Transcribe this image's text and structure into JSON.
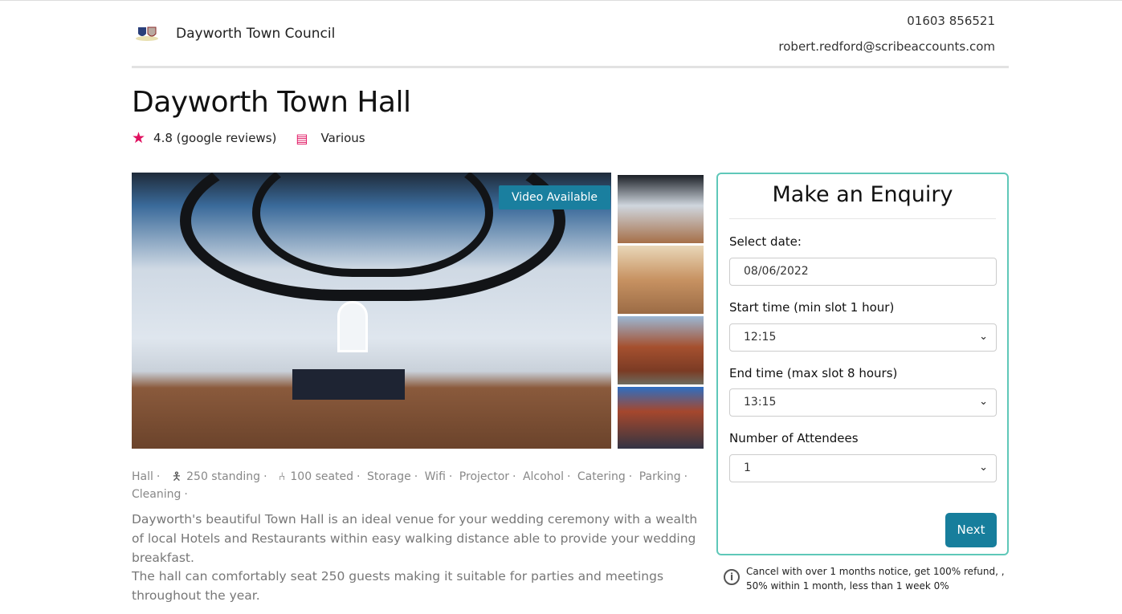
{
  "header": {
    "council_name": "Dayworth Town Council",
    "phone": "01603 856521",
    "email": "robert.redford@scribeaccounts.com"
  },
  "venue": {
    "title": "Dayworth Town Hall",
    "rating": "4.8 (google reviews)",
    "category": "Various",
    "video_label": "Video Available",
    "features": [
      "Hall",
      "250 standing",
      "100 seated",
      "Storage",
      "Wifi",
      "Projector",
      "Alcohol",
      "Catering",
      "Parking",
      "Cleaning"
    ],
    "description": [
      "Dayworth's beautiful Town Hall is an ideal venue for your wedding ceremony with a wealth of local Hotels and Restaurants within easy walking distance able to provide your wedding breakfast.",
      "The hall can comfortably seat 250 guests making it suitable for parties and meetings throughout the year."
    ]
  },
  "enquiry": {
    "title": "Make an Enquiry",
    "date_label": "Select date:",
    "date_value": "08/06/2022",
    "start_label": "Start time (min slot 1 hour)",
    "start_value": "12:15",
    "end_label": "End time (max slot 8 hours)",
    "end_value": "13:15",
    "attendees_label": "Number of Attendees",
    "attendees_value": "1",
    "next_label": "Next",
    "policy": "Cancel with over 1 months notice, get 100% refund, , 50% within 1 month, less than 1 week 0%"
  },
  "colors": {
    "accent": "#177e9c",
    "border": "#5fc8b9",
    "pink": "#e0105f"
  }
}
